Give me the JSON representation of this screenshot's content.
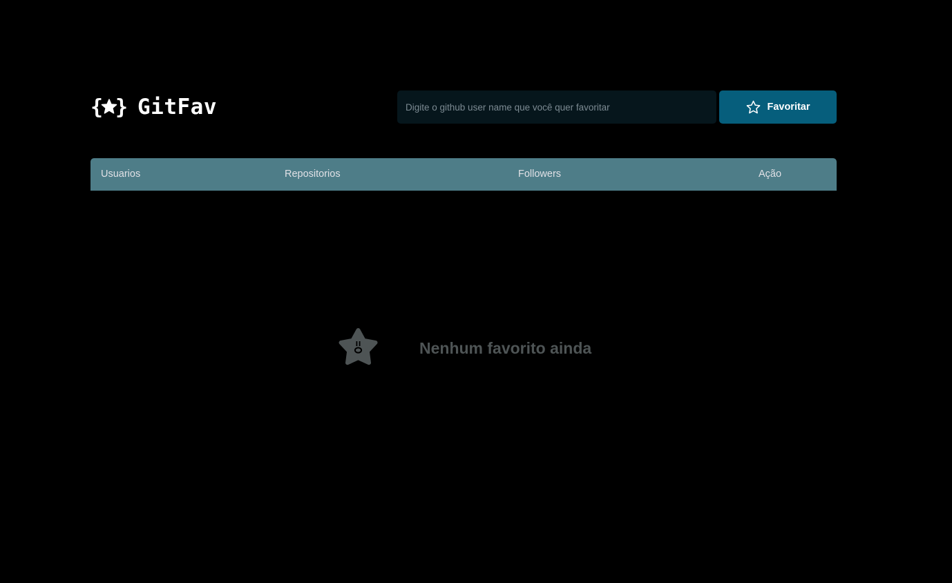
{
  "app": {
    "name": "GitFav",
    "logo_icon": "braces-star-icon",
    "colors": {
      "background": "#000000",
      "input_bg": "#06161c",
      "button_bg": "#065e7c",
      "table_header_bg": "#4e7d88",
      "empty_text": "#4e5455"
    }
  },
  "search": {
    "placeholder": "Digite o github user name que você quer favoritar",
    "value": ""
  },
  "favorite_button": {
    "label": "Favoritar",
    "icon": "star-outline-icon"
  },
  "table": {
    "columns": [
      "Usuarios",
      "Repositorios",
      "Followers",
      "Ação"
    ]
  },
  "empty_state": {
    "icon": "sad-star-icon",
    "message": "Nenhum favorito ainda"
  }
}
